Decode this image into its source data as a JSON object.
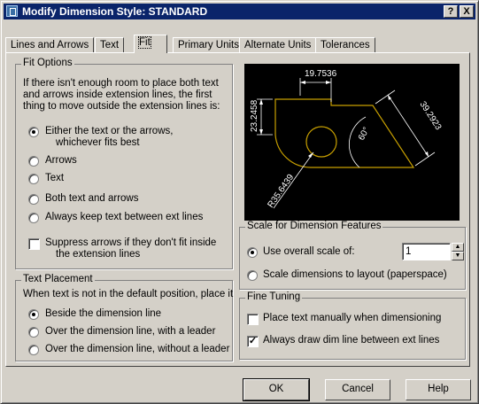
{
  "window": {
    "title": "Modify Dimension Style: STANDARD",
    "help_glyph": "?",
    "close_glyph": "X"
  },
  "tabs": [
    "Lines and Arrows",
    "Text",
    "Fit",
    "Primary Units",
    "Alternate Units",
    "Tolerances"
  ],
  "active_tab": "Fit",
  "fit_options": {
    "legend": "Fit Options",
    "description": [
      "If there isn't enough room to place both text",
      "and arrows inside extension lines, the first",
      "thing to move outside the extension lines is:"
    ],
    "options": [
      {
        "label": "Either the text or the arrows,",
        "label2": "whichever fits best",
        "selected": true
      },
      {
        "label": "Arrows",
        "selected": false
      },
      {
        "label": "Text",
        "selected": false
      },
      {
        "label": "Both text and arrows",
        "selected": false
      },
      {
        "label": "Always keep text between ext lines",
        "selected": false
      }
    ],
    "suppress": {
      "label": "Suppress arrows if they don't fit inside",
      "label2": "the extension lines",
      "checked": false
    }
  },
  "text_placement": {
    "legend": "Text Placement",
    "description": "When text is not in the default position, place it",
    "options": [
      {
        "label": "Beside the dimension line",
        "selected": true
      },
      {
        "label": "Over the dimension line, with a leader",
        "selected": false
      },
      {
        "label": "Over the dimension line, without a leader",
        "selected": false
      }
    ]
  },
  "preview": {
    "dims": [
      "19.7536",
      "23.2458",
      "39.2923",
      "60°",
      "R35.6439"
    ],
    "colors": {
      "background": "#000000",
      "geometry": "#c8a000",
      "dimension": "#ffffff"
    }
  },
  "scale": {
    "legend": "Scale for Dimension Features",
    "use_overall": {
      "label": "Use overall scale of:",
      "selected": true
    },
    "overall_value": "1",
    "to_layout": {
      "label": "Scale dimensions to layout (paperspace)",
      "selected": false
    }
  },
  "fine_tuning": {
    "legend": "Fine Tuning",
    "place_manually": {
      "label": "Place text manually when dimensioning",
      "checked": false
    },
    "always_draw": {
      "label": "Always draw dim line between ext lines",
      "checked": true
    }
  },
  "buttons": {
    "ok": "OK",
    "cancel": "Cancel",
    "help": "Help"
  }
}
